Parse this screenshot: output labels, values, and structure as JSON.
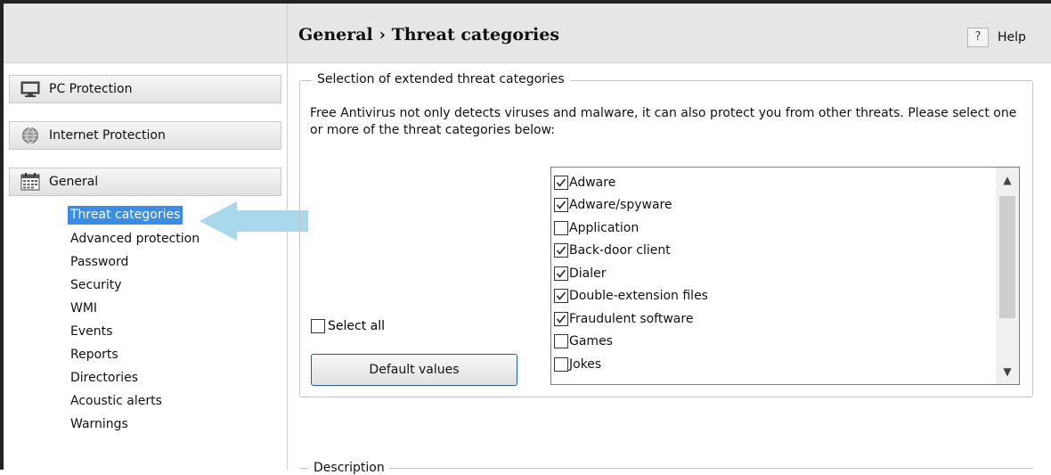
{
  "header": {
    "title": "General › Threat categories",
    "help_glyph": "?",
    "help_label": "Help"
  },
  "sidebar": {
    "sections": [
      {
        "label": "PC Protection",
        "icon": "monitor-icon"
      },
      {
        "label": "Internet Protection",
        "icon": "globe-icon"
      },
      {
        "label": "General",
        "icon": "calendar-icon"
      }
    ],
    "general_items": [
      {
        "label": "Threat categories",
        "selected": true
      },
      {
        "label": "Advanced protection"
      },
      {
        "label": "Password"
      },
      {
        "label": "Security"
      },
      {
        "label": "WMI"
      },
      {
        "label": "Events"
      },
      {
        "label": "Reports"
      },
      {
        "label": "Directories"
      },
      {
        "label": "Acoustic alerts"
      },
      {
        "label": "Warnings"
      }
    ]
  },
  "main": {
    "group_title": "Selection of extended threat categories",
    "intro": "Free Antivirus not only detects viruses and malware, it can also protect you from other threats. Please select one or more of the threat categories below:",
    "select_all_label": "Select all",
    "select_all_checked": false,
    "default_button": "Default values",
    "categories": [
      {
        "label": "Adware",
        "checked": true
      },
      {
        "label": "Adware/spyware",
        "checked": true
      },
      {
        "label": "Application",
        "checked": false
      },
      {
        "label": "Back-door client",
        "checked": true
      },
      {
        "label": "Dialer",
        "checked": true
      },
      {
        "label": "Double-extension files",
        "checked": true
      },
      {
        "label": "Fraudulent software",
        "checked": true
      },
      {
        "label": "Games",
        "checked": false
      },
      {
        "label": "Jokes",
        "checked": false
      }
    ],
    "description_title": "Description"
  },
  "colors": {
    "selection": "#3b8ce4",
    "arrow": "#a9d8ec",
    "header_bg": "#e6e6e6",
    "button_border": "#1f5fa8"
  }
}
